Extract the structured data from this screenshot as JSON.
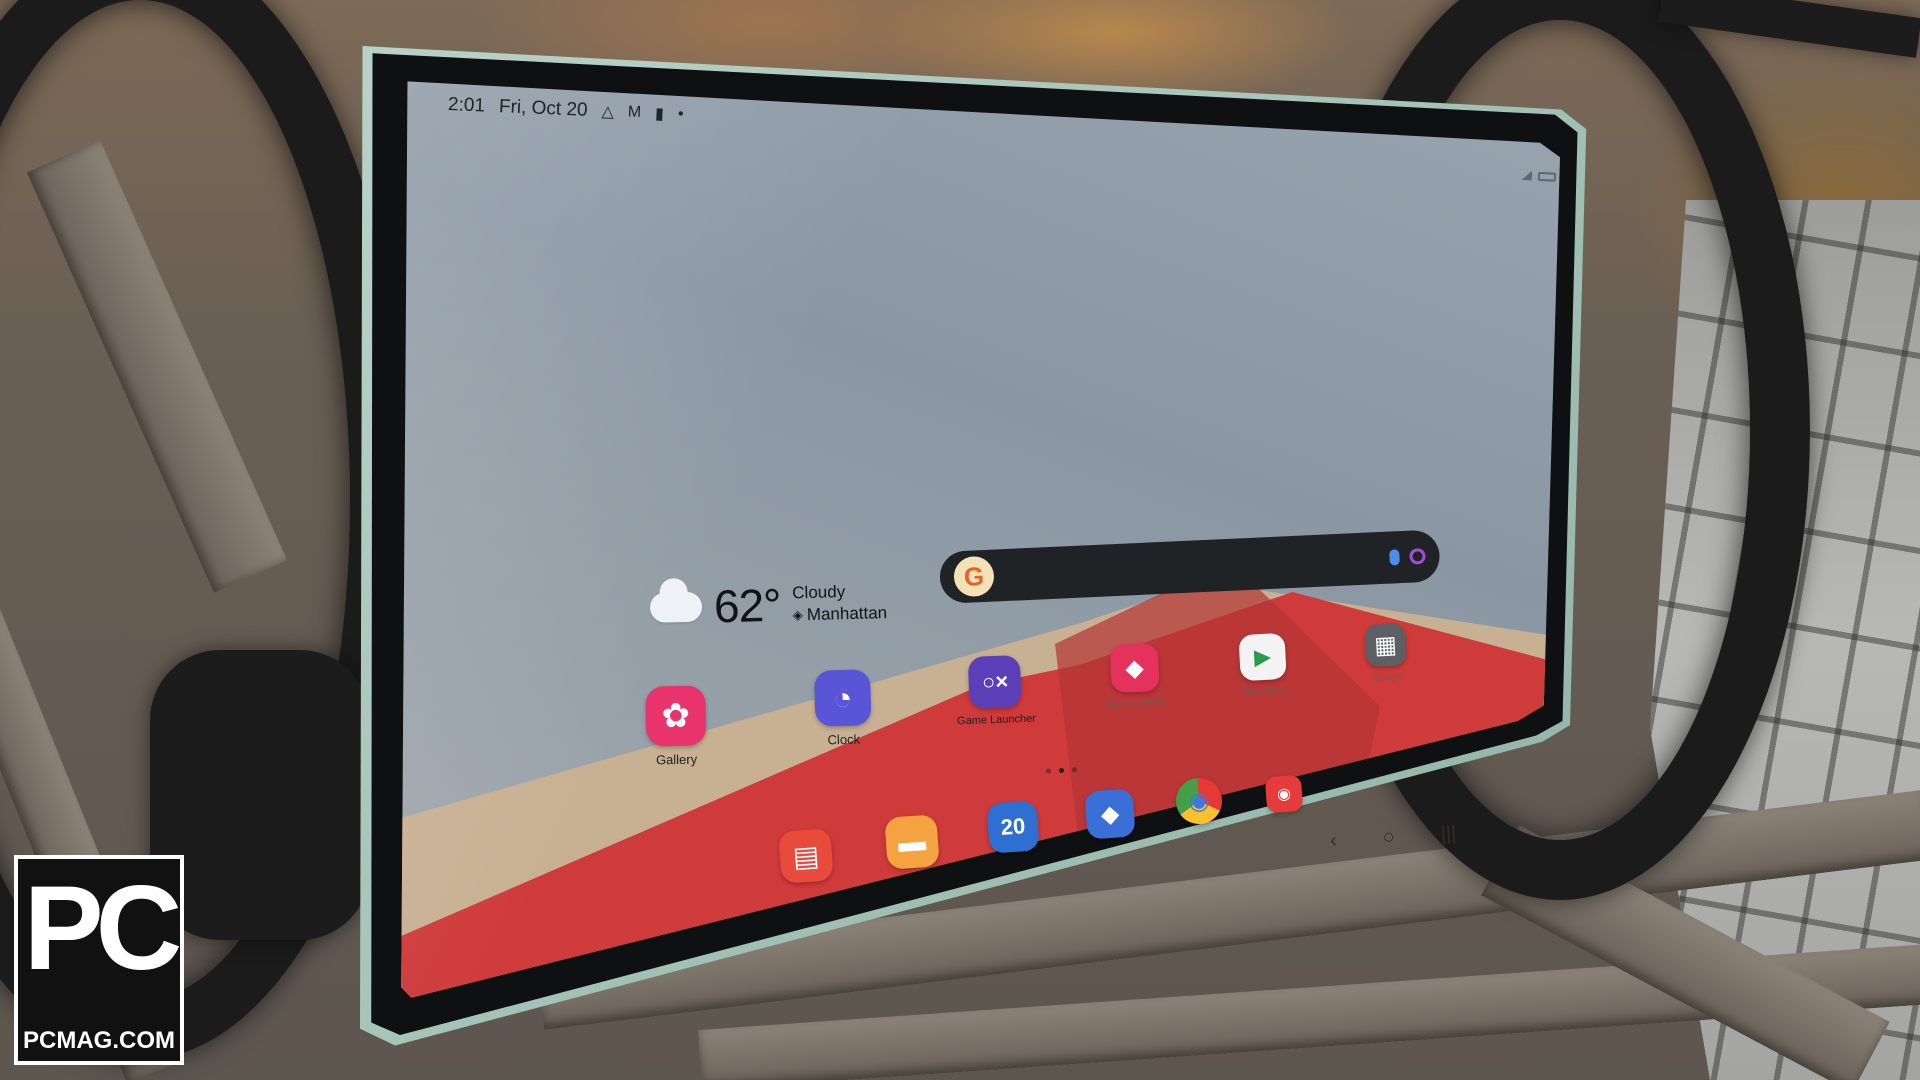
{
  "status_bar": {
    "time": "2:01",
    "date": "Fri, Oct 20",
    "icons": [
      "drive-icon",
      "gmail-icon",
      "battery-icon",
      "dot-icon"
    ],
    "right_icons": [
      "signal-icon",
      "battery-icon"
    ]
  },
  "weather": {
    "temperature": "62°",
    "condition": "Cloudy",
    "location": "Manhattan",
    "icon": "cloud-icon"
  },
  "search_bar": {
    "logo": "G",
    "icons": [
      "mic-icon",
      "lens-icon"
    ]
  },
  "home_apps": [
    {
      "name": "Gallery",
      "icon": "gallery-icon",
      "glyph": "✿",
      "color": "#e8336d"
    },
    {
      "name": "Clock",
      "icon": "clock-icon",
      "glyph": "◔",
      "color": "#5a54d6"
    },
    {
      "name": "Game Launcher",
      "icon": "game-launcher-icon",
      "glyph": "○×",
      "color": "#5b3fb8"
    },
    {
      "name": "Galaxy Store",
      "icon": "galaxy-store-icon",
      "glyph": "◆",
      "color": "#e4325c"
    },
    {
      "name": "Play Store",
      "icon": "play-store-icon",
      "glyph": "▶",
      "color": "#f3f3f3"
    },
    {
      "name": "Google",
      "icon": "google-folder-icon",
      "glyph": "▦",
      "color": "#5c5f63"
    }
  ],
  "dock_apps": [
    {
      "icon": "samsung-notes-icon",
      "glyph": "▤",
      "color": "#e84a3b",
      "label": ""
    },
    {
      "icon": "my-files-icon",
      "glyph": "▬",
      "color": "#f4a340",
      "label": ""
    },
    {
      "icon": "calendar-icon",
      "glyph": "",
      "color": "#2f6fd1",
      "label": "20"
    },
    {
      "icon": "messages-icon",
      "glyph": "◆",
      "color": "#3b6fd8",
      "label": ""
    },
    {
      "icon": "chrome-icon",
      "glyph": "◉",
      "color": "#f3f3f3",
      "label": ""
    },
    {
      "icon": "camera-icon",
      "glyph": "◉",
      "color": "#e63b3b",
      "label": ""
    }
  ],
  "page_indicator": {
    "pages": 3,
    "active": 2
  },
  "nav_bar": {
    "back": "‹",
    "home": "○",
    "recents": "|||"
  },
  "watermark": {
    "big": "PC",
    "small": "PCMAG.COM"
  }
}
